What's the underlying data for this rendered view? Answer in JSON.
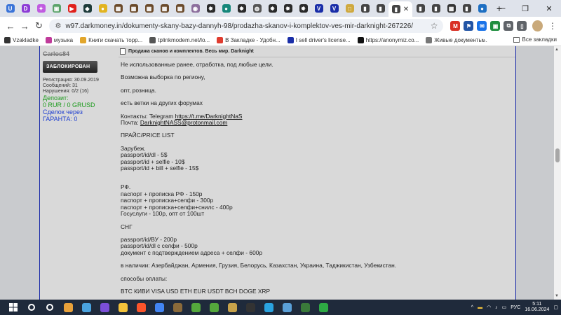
{
  "browser": {
    "tabs": [
      {
        "icon": "u-icon",
        "color": "#3b74d8",
        "glyph": "U"
      },
      {
        "icon": "play-icon",
        "color": "#8d3cd6",
        "glyph": "D"
      },
      {
        "icon": "star-icon",
        "color": "#c05be0",
        "glyph": "✦"
      },
      {
        "icon": "image-icon",
        "color": "#5ba36a",
        "glyph": "▣"
      },
      {
        "icon": "youtube-icon",
        "color": "#e0201b",
        "glyph": "▶"
      },
      {
        "icon": "shield-icon",
        "color": "#1e3b3b",
        "glyph": "◆"
      },
      {
        "icon": "coin-icon",
        "color": "#e2b421",
        "glyph": "●"
      },
      {
        "icon": "forum-icon",
        "color": "#6b4a2a",
        "glyph": "▦"
      },
      {
        "icon": "forum-icon",
        "color": "#6b4a2a",
        "glyph": "▦"
      },
      {
        "icon": "forum-icon",
        "color": "#6b4a2a",
        "glyph": "▦"
      },
      {
        "icon": "forum-icon",
        "color": "#6b4a2a",
        "glyph": "▦"
      },
      {
        "icon": "forum-icon",
        "color": "#6b4a2a",
        "glyph": "▦"
      },
      {
        "icon": "swirl-icon",
        "color": "#8c6e9c",
        "glyph": "◉"
      },
      {
        "icon": "gear-icon",
        "color": "#2a2a2a",
        "glyph": "✸"
      },
      {
        "icon": "globe-icon",
        "color": "#16877a",
        "glyph": "●"
      },
      {
        "icon": "gear-icon",
        "color": "#2a2a2a",
        "glyph": "✸"
      },
      {
        "icon": "globe-icon",
        "color": "#555",
        "glyph": "◍"
      },
      {
        "icon": "gear-icon",
        "color": "#2a2a2a",
        "glyph": "✸"
      },
      {
        "icon": "gear-icon",
        "color": "#2a2a2a",
        "glyph": "✸"
      },
      {
        "icon": "gear-icon",
        "color": "#2a2a2a",
        "glyph": "✸"
      },
      {
        "icon": "v-icon",
        "color": "#1a2ea8",
        "glyph": "V"
      },
      {
        "icon": "v-icon",
        "color": "#1a2ea8",
        "glyph": "V"
      },
      {
        "icon": "square-icon",
        "color": "#cfa93f",
        "glyph": "□"
      },
      {
        "icon": "bars-icon",
        "color": "#444",
        "glyph": "▮"
      },
      {
        "icon": "bars-icon",
        "color": "#444",
        "glyph": "▮"
      }
    ],
    "active_tab": {
      "icon": "bars-icon",
      "color": "#444",
      "glyph": "▮",
      "close": "✕"
    },
    "tabs_after": [
      {
        "icon": "bars-icon",
        "color": "#444",
        "glyph": "▮"
      },
      {
        "icon": "bars-icon",
        "color": "#444",
        "glyph": "▮"
      },
      {
        "icon": "grid-icon",
        "color": "#333",
        "glyph": "▦"
      },
      {
        "icon": "bars-icon",
        "color": "#444",
        "glyph": "▮"
      },
      {
        "icon": "globe-icon",
        "color": "#1d6fc2",
        "glyph": "●"
      }
    ],
    "new_tab": "+",
    "window_controls": {
      "minimize": "—",
      "restore": "❐",
      "close": "✕"
    },
    "nav": {
      "back": "←",
      "forward": "→",
      "reload": "↻"
    },
    "url": "w97.darkmoney.in/dokumenty-skany-bazy-dannyh-98/prodazha-skanov-i-komplektov-ves-mir-darknight-267226/",
    "extensions": [
      {
        "icon": "gmail-icon",
        "color": "#d93025",
        "glyph": "M"
      },
      {
        "icon": "flag-icon",
        "color": "#2254a5",
        "glyph": "⚑"
      },
      {
        "icon": "mail-icon",
        "color": "#1a73e8",
        "glyph": "✉"
      },
      {
        "icon": "green-ext-icon",
        "color": "#1e8e3e",
        "glyph": "▣"
      },
      {
        "icon": "puzzle-icon",
        "color": "#5f6368",
        "glyph": "⧉"
      },
      {
        "icon": "sidepanel-icon",
        "color": "#5f6368",
        "glyph": "▯"
      }
    ],
    "bookmarks": [
      {
        "label": "Vzakladke",
        "color": "#333"
      },
      {
        "label": "музыка",
        "color": "#c03a9a"
      },
      {
        "label": "Книги скачать торр...",
        "color": "#e2a62b"
      },
      {
        "label": "tplinkmodem.net/lo...",
        "color": "#555"
      },
      {
        "label": "В Закладке - Удобн...",
        "color": "#e03c2f"
      },
      {
        "label": "I sell driver's license...",
        "color": "#1a2ea8"
      },
      {
        "label": "https://anonymiz.co...",
        "color": "#111"
      },
      {
        "label": "Живые документы...",
        "color": "#777"
      }
    ],
    "bookmarks_more": "»",
    "all_bookmarks": "Все закладки"
  },
  "forum": {
    "user": {
      "name": "Carlos84",
      "banned_badge": "ЗАБЛОКИРОВАН",
      "stats": [
        "Регистрация: 30.09.2019",
        "Сообщений: 31",
        "Нарушения: 0/2 (16)"
      ],
      "deposit_label": "Депозит:",
      "deposit_value": "0 RUR / 0 GRUSD",
      "deal_line1": "Сделок через",
      "deal_line2": "ГАРАНТА: 0"
    },
    "post": {
      "title": "Продажа сканов и комплектов. Весь мир. Darknight",
      "lines": {
        "l1": "Не использованные ранее, отработка, под любые цели.",
        "l2": "Возможна выборка по региону,",
        "l3": "опт, розница.",
        "l4": "есть ветки на других форумах",
        "contacts_prefix": "Контакты: Telegram ",
        "contacts_link": "https://t.me/DarknightNaS",
        "mail_prefix": "Почта: ",
        "mail_link": "DarknightNASS@protonmail.com",
        "price_header": "ПРАЙС/PRICE LIST",
        "abroad": "Зарубеж.",
        "p1": "passport/id/dl - 5$",
        "p2": "passport/id + selfie - 10$",
        "p3": "passport/id + bill + selfie - 15$",
        "rf": "РФ.",
        "r1": "паспорт + прописка РФ - 150р",
        "r2": "паспорт + прописка+селфи - 300р",
        "r3": "паспорт + прописка+селфи+снилс - 400р",
        "r4": "Госуслуги - 100р, опт от 100шт",
        "cis": "СНГ",
        "c1": "passport/id/ВУ - 200р",
        "c2": "passport/id/dl с селфи - 500р",
        "c3": "документ с подтверждением адреса + селфи - 600р",
        "stock": "в наличии: Азербайджан, Армения, Грузия, Белорусь, Казахстан, Украина, Таджикистан, Узбекистан.",
        "pay_header": "способы оплаты:",
        "pay_methods": "BTC КИВИ VISA USD ETH EUR USDT BCH DOGE XRP"
      }
    }
  },
  "taskbar": {
    "items": [
      {
        "icon": "search-icon",
        "color": "#ffffff"
      },
      {
        "icon": "settings-icon",
        "color": "#ffffff"
      },
      {
        "icon": "colorful-app-icon",
        "color": "#e8a13a"
      },
      {
        "icon": "photos-icon",
        "color": "#4aa3df"
      },
      {
        "icon": "g-app-icon",
        "color": "#7b4fd8"
      },
      {
        "icon": "file-explorer-icon",
        "color": "#f3c33b"
      },
      {
        "icon": "brave-icon",
        "color": "#fb542b"
      },
      {
        "icon": "chrome-icon",
        "color": "#4285f4"
      },
      {
        "icon": "forum-app-icon",
        "color": "#8a6a3a"
      },
      {
        "icon": "utorrent-icon",
        "color": "#54a83c"
      },
      {
        "icon": "utorrent-icon",
        "color": "#54a83c"
      },
      {
        "icon": "tool-icon",
        "color": "#c7a24a"
      },
      {
        "icon": "xbox-icon",
        "color": "#333333"
      },
      {
        "icon": "telegram-icon",
        "color": "#2aa3e0"
      },
      {
        "icon": "notepad-icon",
        "color": "#5aa0d8"
      },
      {
        "icon": "bars-app-icon",
        "color": "#3a7a3a"
      },
      {
        "icon": "green-app-icon",
        "color": "#2eaa44"
      }
    ],
    "tray": {
      "chevron": "^",
      "language": "РУС",
      "time": "5:11",
      "date": "16.06.2024"
    }
  }
}
